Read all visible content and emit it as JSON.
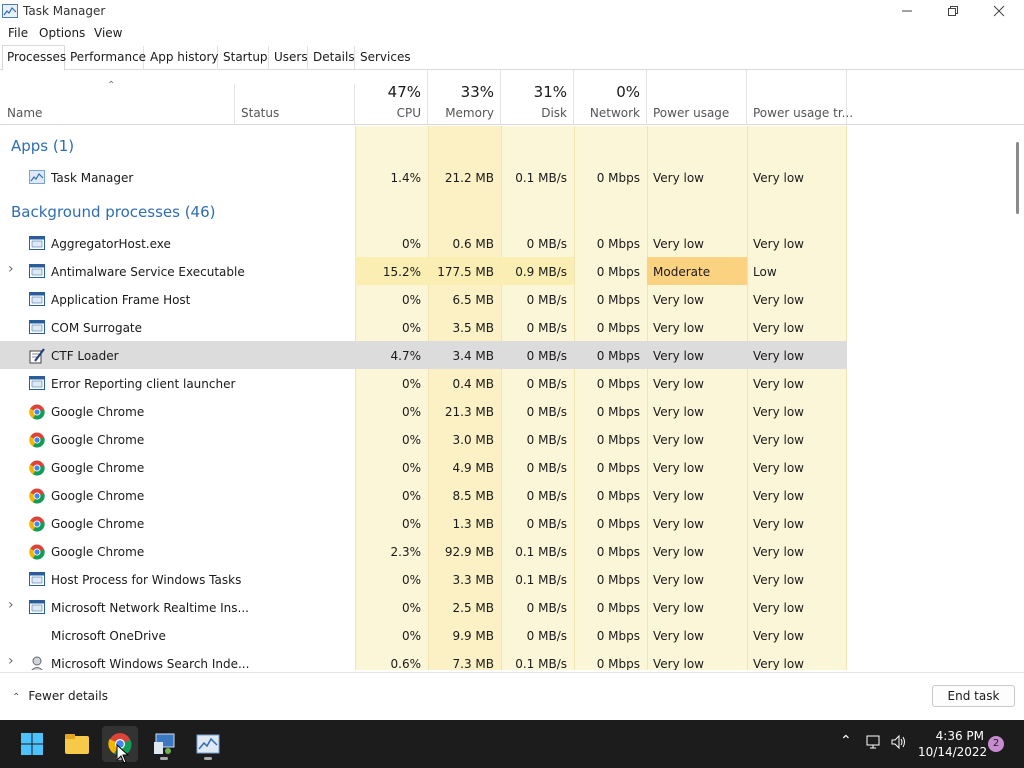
{
  "window": {
    "title": "Task Manager"
  },
  "menu": [
    "File",
    "Options",
    "View"
  ],
  "tabs": [
    {
      "label": "Processes",
      "active": true
    },
    {
      "label": "Performance"
    },
    {
      "label": "App history"
    },
    {
      "label": "Startup"
    },
    {
      "label": "Users"
    },
    {
      "label": "Details"
    },
    {
      "label": "Services"
    }
  ],
  "header": {
    "name": "Name",
    "status": "Status",
    "cpu": {
      "pct": "47%",
      "label": "CPU"
    },
    "memory": {
      "pct": "33%",
      "label": "Memory"
    },
    "disk": {
      "pct": "31%",
      "label": "Disk"
    },
    "network": {
      "pct": "0%",
      "label": "Network"
    },
    "power": "Power usage",
    "power_trend": "Power usage tr..."
  },
  "groups": {
    "apps": "Apps (1)",
    "background": "Background processes (46)"
  },
  "rows": [
    {
      "name": "Task Manager",
      "icon": "task-manager-icon",
      "cpu": "1.4%",
      "mem": "21.2 MB",
      "disk": "0.1 MB/s",
      "net": "0 Mbps",
      "power": "Very low",
      "trend": "Very low"
    },
    {
      "name": "AggregatorHost.exe",
      "icon": "window-icon",
      "cpu": "0%",
      "mem": "0.6 MB",
      "disk": "0 MB/s",
      "net": "0 Mbps",
      "power": "Very low",
      "trend": "Very low"
    },
    {
      "name": "Antimalware Service Executable",
      "icon": "window-icon",
      "expand": true,
      "cpu": "15.2%",
      "mem": "177.5 MB",
      "disk": "0.9 MB/s",
      "net": "0 Mbps",
      "power": "Moderate",
      "trend": "Low"
    },
    {
      "name": "Application Frame Host",
      "icon": "window-icon",
      "cpu": "0%",
      "mem": "6.5 MB",
      "disk": "0 MB/s",
      "net": "0 Mbps",
      "power": "Very low",
      "trend": "Very low"
    },
    {
      "name": "COM Surrogate",
      "icon": "window-icon",
      "cpu": "0%",
      "mem": "3.5 MB",
      "disk": "0 MB/s",
      "net": "0 Mbps",
      "power": "Very low",
      "trend": "Very low"
    },
    {
      "name": "CTF Loader",
      "icon": "ctf-loader-icon",
      "selected": true,
      "cpu": "4.7%",
      "mem": "3.4 MB",
      "disk": "0 MB/s",
      "net": "0 Mbps",
      "power": "Very low",
      "trend": "Very low"
    },
    {
      "name": "Error Reporting client launcher",
      "icon": "window-icon",
      "cpu": "0%",
      "mem": "0.4 MB",
      "disk": "0 MB/s",
      "net": "0 Mbps",
      "power": "Very low",
      "trend": "Very low"
    },
    {
      "name": "Google Chrome",
      "icon": "chrome-icon",
      "cpu": "0%",
      "mem": "21.3 MB",
      "disk": "0 MB/s",
      "net": "0 Mbps",
      "power": "Very low",
      "trend": "Very low"
    },
    {
      "name": "Google Chrome",
      "icon": "chrome-icon",
      "cpu": "0%",
      "mem": "3.0 MB",
      "disk": "0 MB/s",
      "net": "0 Mbps",
      "power": "Very low",
      "trend": "Very low"
    },
    {
      "name": "Google Chrome",
      "icon": "chrome-icon",
      "cpu": "0%",
      "mem": "4.9 MB",
      "disk": "0 MB/s",
      "net": "0 Mbps",
      "power": "Very low",
      "trend": "Very low"
    },
    {
      "name": "Google Chrome",
      "icon": "chrome-icon",
      "cpu": "0%",
      "mem": "8.5 MB",
      "disk": "0 MB/s",
      "net": "0 Mbps",
      "power": "Very low",
      "trend": "Very low"
    },
    {
      "name": "Google Chrome",
      "icon": "chrome-icon",
      "cpu": "0%",
      "mem": "1.3 MB",
      "disk": "0 MB/s",
      "net": "0 Mbps",
      "power": "Very low",
      "trend": "Very low"
    },
    {
      "name": "Google Chrome",
      "icon": "chrome-icon",
      "cpu": "2.3%",
      "mem": "92.9 MB",
      "disk": "0.1 MB/s",
      "net": "0 Mbps",
      "power": "Very low",
      "trend": "Very low"
    },
    {
      "name": "Host Process for Windows Tasks",
      "icon": "window-icon",
      "cpu": "0%",
      "mem": "3.3 MB",
      "disk": "0.1 MB/s",
      "net": "0 Mbps",
      "power": "Very low",
      "trend": "Very low"
    },
    {
      "name": "Microsoft Network Realtime Ins...",
      "icon": "window-icon",
      "expand": true,
      "cpu": "0%",
      "mem": "2.5 MB",
      "disk": "0 MB/s",
      "net": "0 Mbps",
      "power": "Very low",
      "trend": "Very low"
    },
    {
      "name": "Microsoft OneDrive",
      "icon": "none",
      "cpu": "0%",
      "mem": "9.9 MB",
      "disk": "0 MB/s",
      "net": "0 Mbps",
      "power": "Very low",
      "trend": "Very low"
    },
    {
      "name": "Microsoft Windows Search Inde...",
      "icon": "search-indexer-icon",
      "expand": true,
      "cpu": "0.6%",
      "mem": "7.3 MB",
      "disk": "0.1 MB/s",
      "net": "0 Mbps",
      "power": "Very low",
      "trend": "Very low"
    }
  ],
  "footer": {
    "fewer_details": "Fewer details",
    "end_task": "End task"
  },
  "taskbar": {
    "time": "4:36 PM",
    "date": "10/14/2022",
    "notifications": "2"
  },
  "colors": {
    "heat_light": "#fcf6d8",
    "heat_mid": "#fbeeb3",
    "heat_high": "#fbd27f",
    "group_title": "#2e6db4",
    "selected_row": "#dcdcdc"
  }
}
